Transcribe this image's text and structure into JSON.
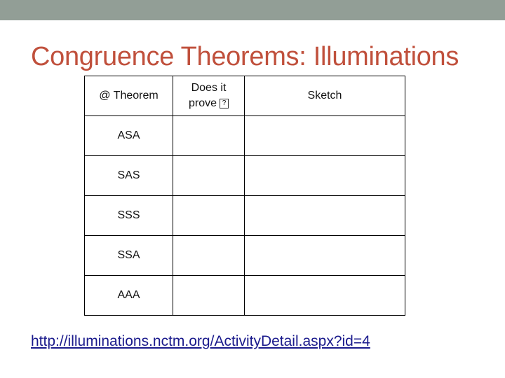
{
  "slide": {
    "title": "Congruence Theorems:  Illuminations",
    "table": {
      "headers": [
        "@ Theorem",
        "Does it",
        "prove",
        "Sketch"
      ],
      "missing_glyph": "?",
      "rows": [
        {
          "theorem": "ASA",
          "proves": "",
          "sketch": ""
        },
        {
          "theorem": "SAS",
          "proves": "",
          "sketch": ""
        },
        {
          "theorem": "SSS",
          "proves": "",
          "sketch": ""
        },
        {
          "theorem": "SSA",
          "proves": "",
          "sketch": ""
        },
        {
          "theorem": "AAA",
          "proves": "",
          "sketch": ""
        }
      ]
    },
    "link": "http://illuminations.nctm.org/ActivityDetail.aspx?id=4"
  },
  "colors": {
    "top_bar": "#929e96",
    "title": "#c0503c",
    "link": "#1a1a8c"
  }
}
